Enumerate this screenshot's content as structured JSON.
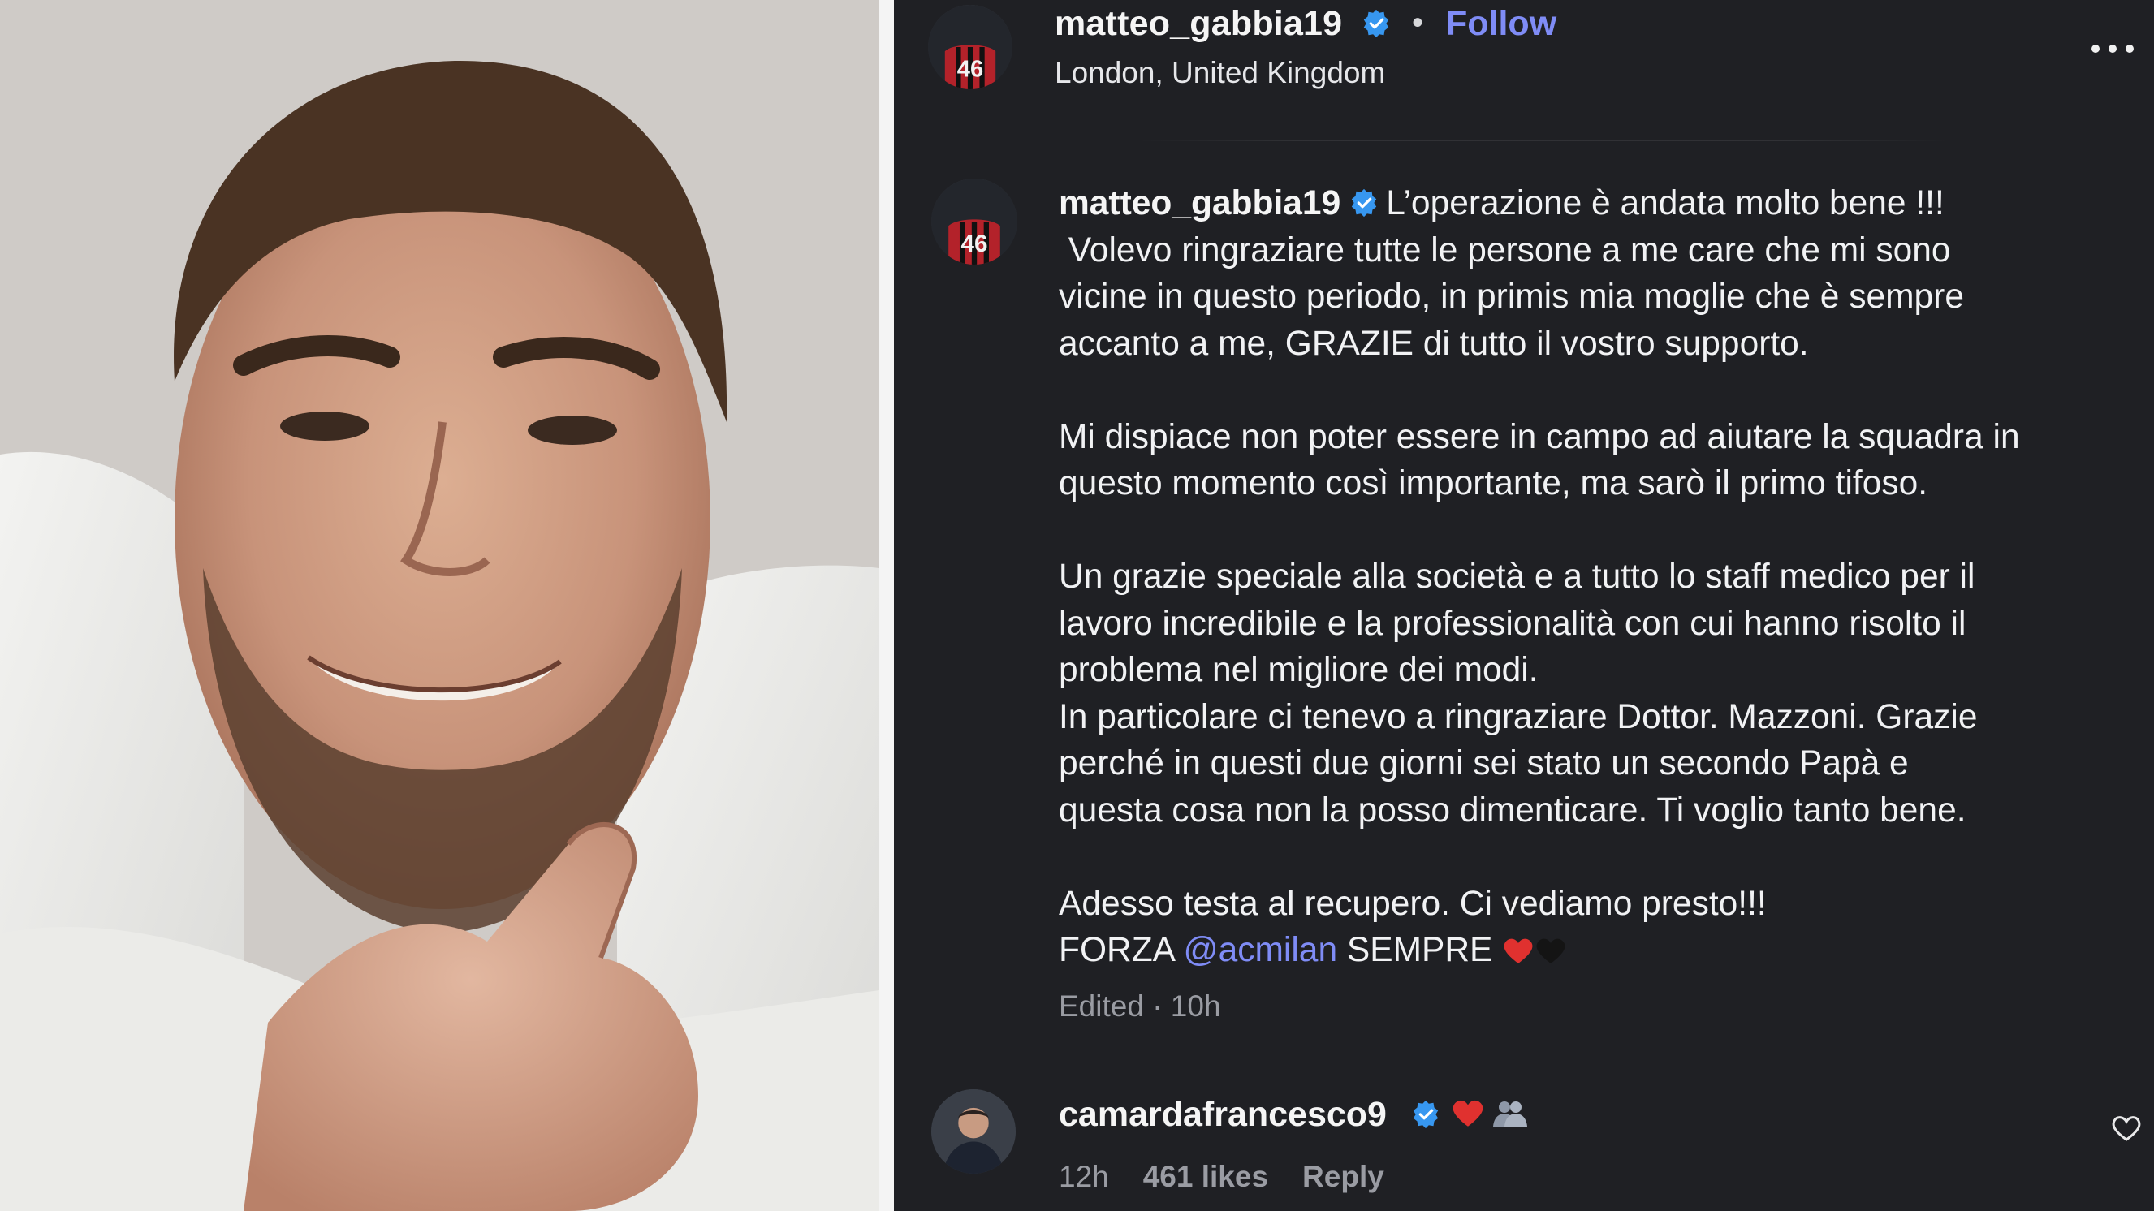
{
  "header": {
    "username": "matteo_gabbia19",
    "separator": "•",
    "follow_label": "Follow",
    "location": "London, United Kingdom"
  },
  "post": {
    "username": "matteo_gabbia19",
    "caption_lines": [
      "L’operazione è andata molto bene !!!",
      " Volevo ringraziare tutte le persone a me care che mi sono",
      "vicine in questo periodo, in primis mia moglie che è sempre",
      "accanto a me, GRAZIE di tutto il vostro supporto.",
      "",
      "Mi dispiace non poter essere in campo ad aiutare la squadra in",
      "questo momento così importante, ma sarò il primo tifoso.",
      "",
      "Un grazie speciale alla società e a tutto lo staff medico per il",
      "lavoro incredibile e la professionalità con cui hanno risolto il",
      "problema nel migliore dei modi.",
      "In particolare ci tenevo a ringraziare Dottor. Mazzoni. Grazie",
      "perché in questi due giorni sei stato un secondo Papà e",
      "questa cosa non la posso dimenticare. Ti voglio tanto bene.",
      "",
      "Adesso testa al recupero. Ci vediamo presto!!!"
    ],
    "last_line_prefix": "FORZA ",
    "mention": "@acmilan",
    "last_line_suffix": " SEMPRE ",
    "meta": "Edited · 10h",
    "avatar_number": "46"
  },
  "comment": {
    "username": "camardafrancesco9",
    "time": "12h",
    "likes": "461 likes",
    "reply_label": "Reply"
  },
  "colors": {
    "panel_bg": "#1f2024",
    "link_blue": "#7f8cf6",
    "verified_blue": "#3797f0",
    "muted_text": "#9a9ca3"
  },
  "icons": {
    "header_more": "more-horizontal-icon",
    "verified": "verified-badge-icon",
    "like": "heart-outline-icon"
  }
}
